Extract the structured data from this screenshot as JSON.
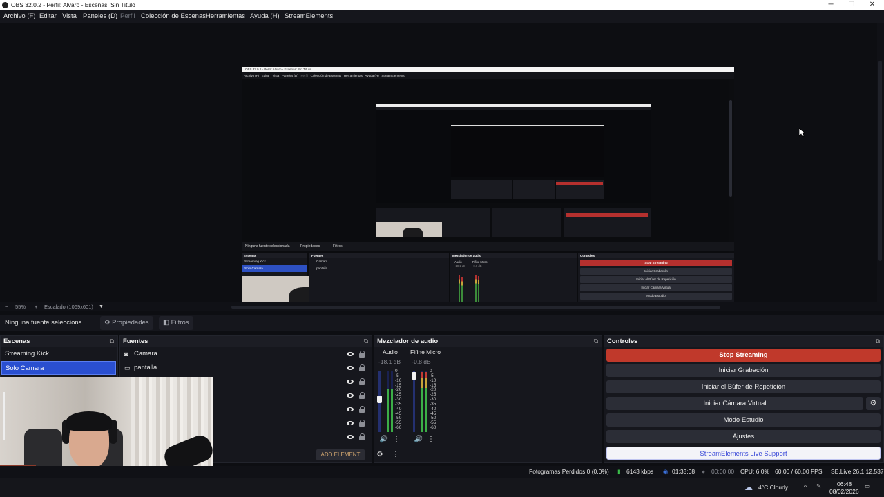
{
  "window": {
    "title": "OBS 32.0.2 - Perfil: Alvaro - Escenas: Sin Título",
    "min": "─",
    "max": "❐",
    "close": "✕"
  },
  "menu": [
    "Archivo (F)",
    "Editar",
    "Vista",
    "Paneles (D)",
    "Perfil",
    "Colección de Escenas",
    "Herramientas",
    "Ayuda (H)",
    "StreamElements"
  ],
  "preview": {
    "nested": {
      "title": "OBS 32.0.2 - Perfil: Alvaro - Escenas: Sin Título",
      "menu": [
        "Archivo (F)",
        "Editar",
        "Vista",
        "Paneles (D)",
        "Perfil",
        "Colección de Escenas",
        "Herramientas",
        "Ayuda (H)",
        "StreamElements"
      ],
      "zoom": "55%",
      "scale_mode": "Escalado (1069x601)",
      "no_source": "Ninguna fuente seleccionada",
      "props": "Propiedades",
      "filters": "Filtros",
      "docks": {
        "scenes": "Escenas",
        "sources": "Fuentes",
        "mixer": "Mezclador de audio",
        "controls": "Controles"
      },
      "scenes": [
        "Streaming Kick",
        "Solo Camara"
      ],
      "sources": [
        "Camara",
        "pantalla"
      ],
      "channels": [
        {
          "name": "Audio",
          "db": "-18.1 dB"
        },
        {
          "name": "Fifine Micro",
          "db": "-0.8 dB"
        }
      ],
      "controls": [
        "Stop Streaming",
        "Iniciar Grabación",
        "Iniciar el Búfer de Repetición",
        "Iniciar Cámara Virtual",
        "Modo Estudio"
      ]
    }
  },
  "zoombar": {
    "minus": "−",
    "plus": "+",
    "zoom": "55%",
    "scale_mode": "Escalado (1069x601)",
    "caret": "▼"
  },
  "sourcebar": {
    "no_source": "Ninguna fuente seleccionada",
    "props": "Propiedades",
    "filters": "Filtros",
    "props_icon": "gear-icon",
    "filters_icon": "filter-icon"
  },
  "scenes_dock": {
    "title": "Escenas",
    "items": [
      {
        "label": "Streaming Kick",
        "selected": false
      },
      {
        "label": "Solo Camara",
        "selected": true
      }
    ]
  },
  "sources_dock": {
    "title": "Fuentes",
    "items": [
      {
        "label": "Camara",
        "icon": "camera-icon"
      },
      {
        "label": "pantalla",
        "icon": "monitor-icon"
      }
    ],
    "add_label": "ADD ELEMENT"
  },
  "mixer_dock": {
    "title": "Mezclador de audio",
    "channels": [
      {
        "name": "Audio",
        "db": "-18.1 dB",
        "level": 0.7
      },
      {
        "name": "Fifine Micro",
        "db": "-0.8 dB",
        "level": 0.98
      }
    ],
    "scale": [
      "0",
      "-5",
      "-10",
      "-15",
      "-20",
      "-25",
      "-30",
      "-35",
      "-40",
      "-45",
      "-50",
      "-55",
      "-60"
    ]
  },
  "controls_dock": {
    "title": "Controles",
    "buttons": {
      "stop_streaming": "Stop Streaming",
      "start_recording": "Iniciar Grabación",
      "replay_buffer": "Iniciar el Búfer de Repetición",
      "virtual_cam": "Iniciar Cámara Virtual",
      "studio_mode": "Modo Estudio",
      "settings": "Ajustes",
      "se_support": "StreamElements Live Support"
    },
    "colors": {
      "stop": "#c0392b",
      "se_text": "#3a49d8"
    }
  },
  "status": {
    "dropped_frames": "Fotogramas Perdidos 0 (0.0%)",
    "bitrate": "6143 kbps",
    "stream_time": "01:33:08",
    "rec_time": "00:00:00",
    "cpu": "CPU: 6.0%",
    "fps": "60.00 / 60.00 FPS",
    "se_version": "SE.Live 26.1.12.537"
  },
  "taskbar": {
    "weather": "4°C  Cloudy",
    "time": "06:48",
    "date": "08/02/2026"
  }
}
